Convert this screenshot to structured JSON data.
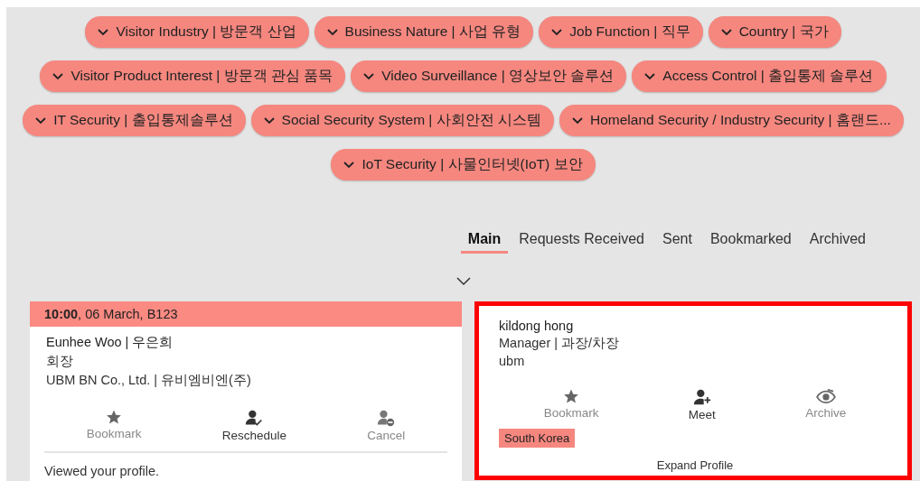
{
  "filter_rows": [
    [
      "Visitor Industry | 방문객 산업",
      "Business Nature | 사업 유형",
      "Job Function | 직무",
      "Country | 국가"
    ],
    [
      "Visitor Product Interest | 방문객 관심 품목",
      "Video Surveillance | 영상보안 솔루션",
      "Access Control | 출입통제 솔루션"
    ],
    [
      "IT Security | 출입통제솔루션",
      "Social Security System | 사회안전 시스템",
      "Homeland Security / Industry Security | 홈랜드..."
    ],
    [
      "IoT Security | 사물인터넷(IoT) 보안"
    ]
  ],
  "tabs": [
    {
      "label": "Main",
      "selected": true
    },
    {
      "label": "Requests Received",
      "selected": false
    },
    {
      "label": "Sent",
      "selected": false
    },
    {
      "label": "Bookmarked",
      "selected": false
    },
    {
      "label": "Archived",
      "selected": false
    }
  ],
  "cards": [
    {
      "header": "**10:00**, 06 March, B123",
      "name": "Eunhee Woo | 우은희",
      "title": "회장",
      "company": "UBM BN Co., Ltd. | 유비엠비엔(주)",
      "highlighted": false,
      "actions": [
        {
          "kind": "bookmark",
          "label": "Bookmark",
          "active": false
        },
        {
          "kind": "reschedule",
          "label": "Reschedule",
          "active": true
        },
        {
          "kind": "cancel",
          "label": "Cancel",
          "active": false
        }
      ],
      "note": "Viewed your profile."
    },
    {
      "name": "kildong hong",
      "title": "Manager | 과장/차장",
      "company": "ubm",
      "highlighted": true,
      "actions": [
        {
          "kind": "bookmark",
          "label": "Bookmark",
          "active": false
        },
        {
          "kind": "meet",
          "label": "Meet",
          "active": true
        },
        {
          "kind": "archive",
          "label": "Archive",
          "active": false
        }
      ],
      "tag": "South Korea",
      "link": "Expand Profile"
    }
  ]
}
